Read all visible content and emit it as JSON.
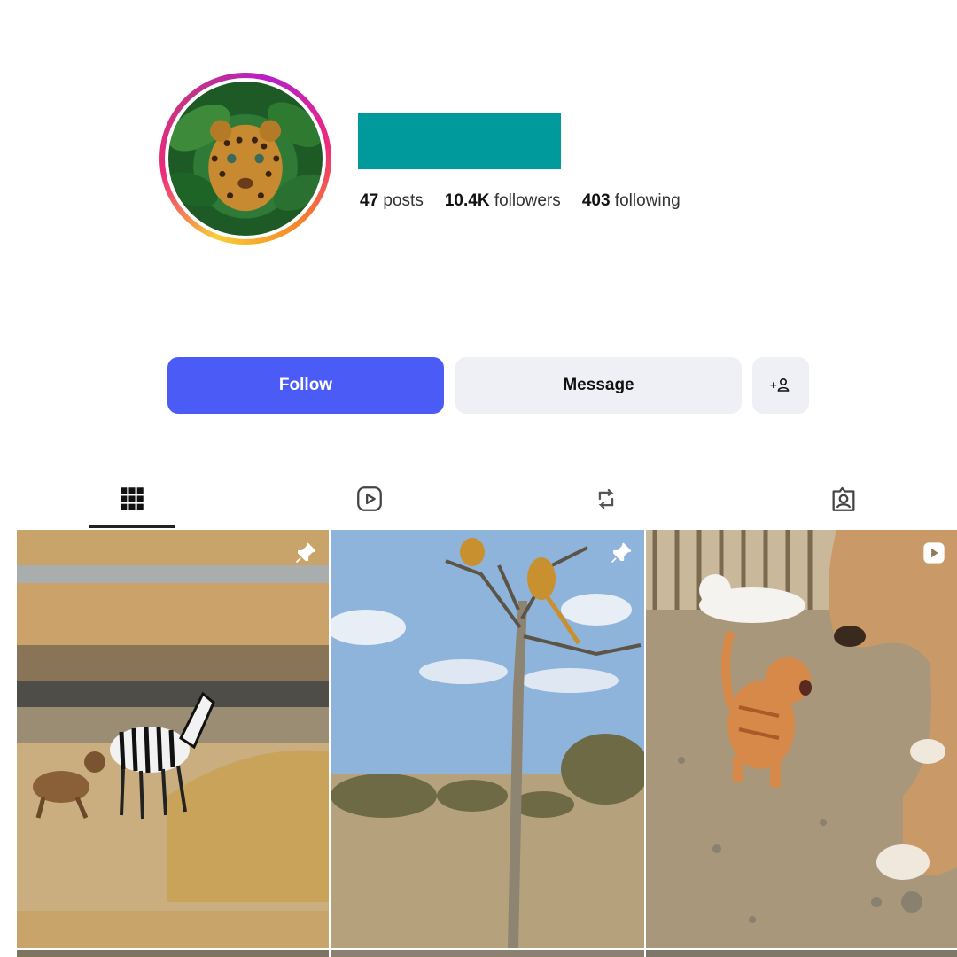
{
  "profile": {
    "stats": {
      "posts_count": "47",
      "posts_label": "posts",
      "followers_count": "10.4K",
      "followers_label": "followers",
      "following_count": "403",
      "following_label": "following"
    },
    "avatar_icon": "leopard-avatar"
  },
  "actions": {
    "follow_label": "Follow",
    "message_label": "Message",
    "suggest_label": "+"
  },
  "tabs": [
    {
      "icon": "grid-icon",
      "active": true
    },
    {
      "icon": "reels-icon",
      "active": false
    },
    {
      "icon": "reposts-icon",
      "active": false
    },
    {
      "icon": "tagged-icon",
      "active": false
    }
  ],
  "posts": [
    {
      "scene": "hyena-zebra-savanna",
      "badge": "pin-icon"
    },
    {
      "scene": "leopards-in-tree",
      "badge": "pin-icon"
    },
    {
      "scene": "kitten-and-dog",
      "badge": "reel-icon"
    }
  ],
  "colors": {
    "follow_button": "#4a5cf5",
    "secondary_button": "#eff0f5",
    "redaction": "#00999c"
  }
}
